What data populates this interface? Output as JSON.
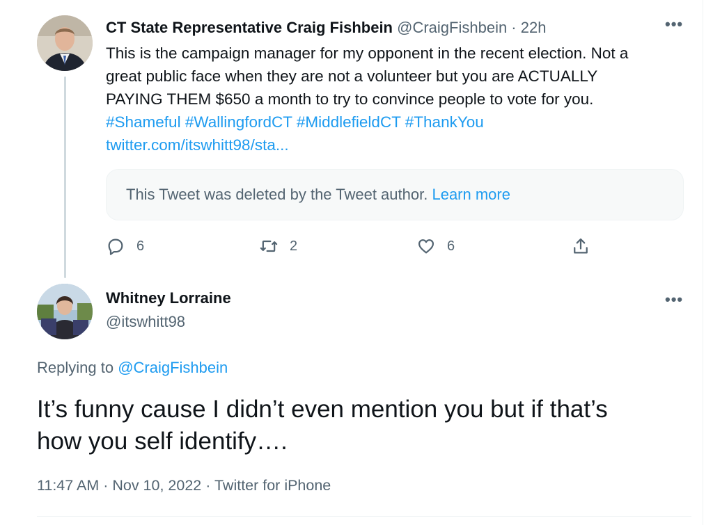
{
  "parent_tweet": {
    "display_name": "CT State Representative Craig Fishbein",
    "handle": "@CraigFishbein",
    "time": " · 22h",
    "more_icon": "more-dots-icon",
    "body_lines": [
      "This is the campaign manager for my opponent in the recent election. Not a",
      "great public face when they are not a volunteer but you are ACTUALLY",
      "PAYING THEM $650 a month to try to convince people to vote for you."
    ],
    "hashtags": "#Shameful #WallingfordCT #MiddlefieldCT #ThankYou",
    "link": "twitter.com/itswhitt98/sta...",
    "quoted_notice": "This Tweet was deleted by the Tweet author.",
    "learn_more": "Learn more",
    "actions": {
      "reply_count": "6",
      "retweet_count": "2",
      "like_count": "6"
    }
  },
  "reply_tweet": {
    "display_name": "Whitney Lorraine",
    "handle": "@itswhitt98",
    "replying_prefix": "Replying to ",
    "replying_to": "@CraigFishbein",
    "text_lines": [
      "It’s funny cause I didn’t even mention you but if that’s",
      "how you self identify…."
    ],
    "timestamp": "11:47 AM · Nov 10, 2022 · Twitter for iPhone"
  },
  "colors": {
    "accent": "#1d9bf0",
    "text": "#0f1419",
    "secondary": "#536471"
  }
}
